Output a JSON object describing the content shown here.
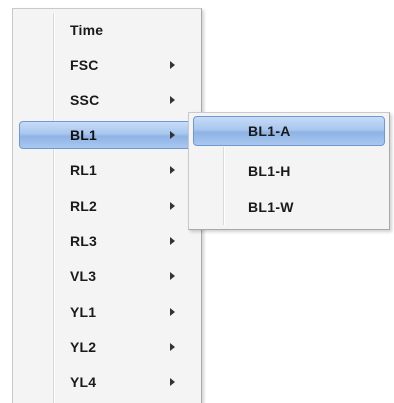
{
  "menu": {
    "items": [
      {
        "label": "Time",
        "has_submenu": false
      },
      {
        "label": "FSC",
        "has_submenu": true
      },
      {
        "label": "SSC",
        "has_submenu": true
      },
      {
        "label": "BL1",
        "has_submenu": true,
        "active": true
      },
      {
        "label": "RL1",
        "has_submenu": true
      },
      {
        "label": "RL2",
        "has_submenu": true
      },
      {
        "label": "RL3",
        "has_submenu": true
      },
      {
        "label": "VL3",
        "has_submenu": true
      },
      {
        "label": "YL1",
        "has_submenu": true
      },
      {
        "label": "YL2",
        "has_submenu": true
      },
      {
        "label": "YL4",
        "has_submenu": true
      }
    ]
  },
  "submenu": {
    "items": [
      {
        "label": "BL1-A",
        "active": true
      },
      {
        "label": "BL1-H"
      },
      {
        "label": "BL1-W"
      }
    ]
  },
  "colors": {
    "highlight": "#a8c6ee",
    "highlight_border": "#6f98d4",
    "menu_background": "#f4f4f4"
  }
}
